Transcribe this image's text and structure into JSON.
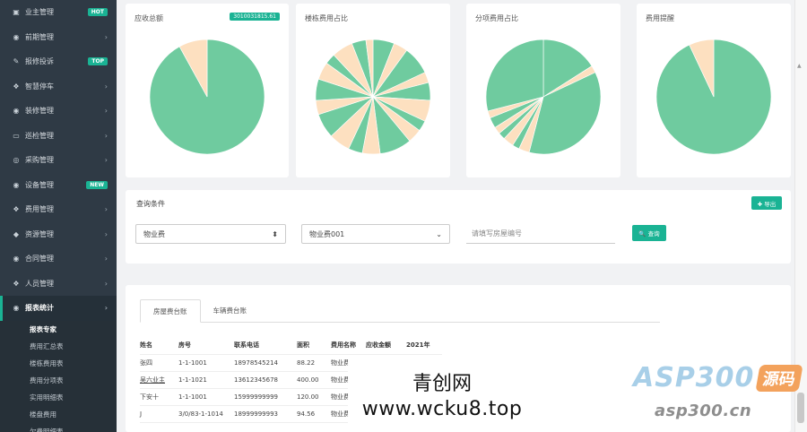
{
  "sidebar": {
    "items": [
      {
        "icon": "▣",
        "label": "业主管理",
        "badge": "HOT",
        "chevron": ""
      },
      {
        "icon": "◉",
        "label": "前期管理",
        "badge": "",
        "chevron": "›"
      },
      {
        "icon": "✎",
        "label": "报修投诉",
        "badge": "TOP",
        "chevron": ""
      },
      {
        "icon": "❖",
        "label": "智慧停车",
        "badge": "",
        "chevron": "›"
      },
      {
        "icon": "◉",
        "label": "装修管理",
        "badge": "",
        "chevron": "›"
      },
      {
        "icon": "▭",
        "label": "巡检管理",
        "badge": "",
        "chevron": "›"
      },
      {
        "icon": "◎",
        "label": "采购管理",
        "badge": "",
        "chevron": "›"
      },
      {
        "icon": "◉",
        "label": "设备管理",
        "badge": "NEW",
        "chevron": ""
      },
      {
        "icon": "❖",
        "label": "费用管理",
        "badge": "",
        "chevron": "›"
      },
      {
        "icon": "◆",
        "label": "资源管理",
        "badge": "",
        "chevron": "›"
      },
      {
        "icon": "◉",
        "label": "合同管理",
        "badge": "",
        "chevron": "›"
      },
      {
        "icon": "❖",
        "label": "人员管理",
        "badge": "",
        "chevron": "›"
      }
    ],
    "active": {
      "icon": "◉",
      "label": "报表统计",
      "chevron": "›"
    },
    "subitems": [
      "报表专家",
      "费用汇总表",
      "楼栋费用表",
      "费用分项表",
      "实用明细表",
      "楼盘费用",
      "欠费明细表"
    ]
  },
  "charts": {
    "c1": {
      "title": "应收总额",
      "badge": "3010031815.61"
    },
    "c2": {
      "title": "楼栋费用占比"
    },
    "c3": {
      "title": "分项费用占比"
    },
    "c4": {
      "title": "费用提醒"
    }
  },
  "chart_data": [
    {
      "type": "pie",
      "title": "应收总额",
      "values": [
        92,
        8
      ],
      "colors": [
        "#6fcb9f",
        "#fde0c0"
      ]
    },
    {
      "type": "pie",
      "title": "楼栋费用占比",
      "values": [
        6,
        4,
        8,
        3,
        5,
        6,
        3,
        4,
        9,
        5,
        4,
        6,
        7,
        4,
        6,
        5,
        3,
        6,
        4,
        2
      ],
      "colors": [
        "#6fcb9f",
        "#fde0c0"
      ]
    },
    {
      "type": "pie",
      "title": "分项费用占比",
      "values": [
        16,
        2,
        36,
        3,
        2,
        3,
        2,
        2,
        3,
        2,
        29
      ],
      "colors": [
        "#6fcb9f",
        "#fde0c0"
      ]
    },
    {
      "type": "pie",
      "title": "费用提醒",
      "values": [
        93,
        7
      ],
      "colors": [
        "#6fcb9f",
        "#fde0c0"
      ]
    }
  ],
  "query": {
    "title": "查询条件",
    "export_label": "✚ 导出",
    "select1": "物业费",
    "select2": "物业费001",
    "room_placeholder": "请填写房屋编号",
    "search_label": "🔍 查询"
  },
  "table": {
    "tabs": [
      "房屋费台账",
      "车辆费台账"
    ],
    "headers": [
      "姓名",
      "房号",
      "联系电话",
      "面积",
      "费用名称",
      "应收金额",
      "2021年"
    ],
    "rows": [
      [
        "张四",
        "1-1-1001",
        "18978545214",
        "88.22",
        "物业费"
      ],
      [
        "吴六业主",
        "1-1-1021",
        "13612345678",
        "400.00",
        "物业费"
      ],
      [
        "下安十",
        "1-1-1001",
        "15999999999",
        "120.00",
        "物业费"
      ],
      [
        "J",
        "3/0/83-1-1014",
        "18999999993",
        "94.56",
        "物业费"
      ]
    ]
  },
  "watermark": {
    "line1": "青创网",
    "line2": "www.wcku8.top",
    "logo_main": "ASP300",
    "logo_tag": "源码",
    "logo_url": "asp300.cn"
  }
}
